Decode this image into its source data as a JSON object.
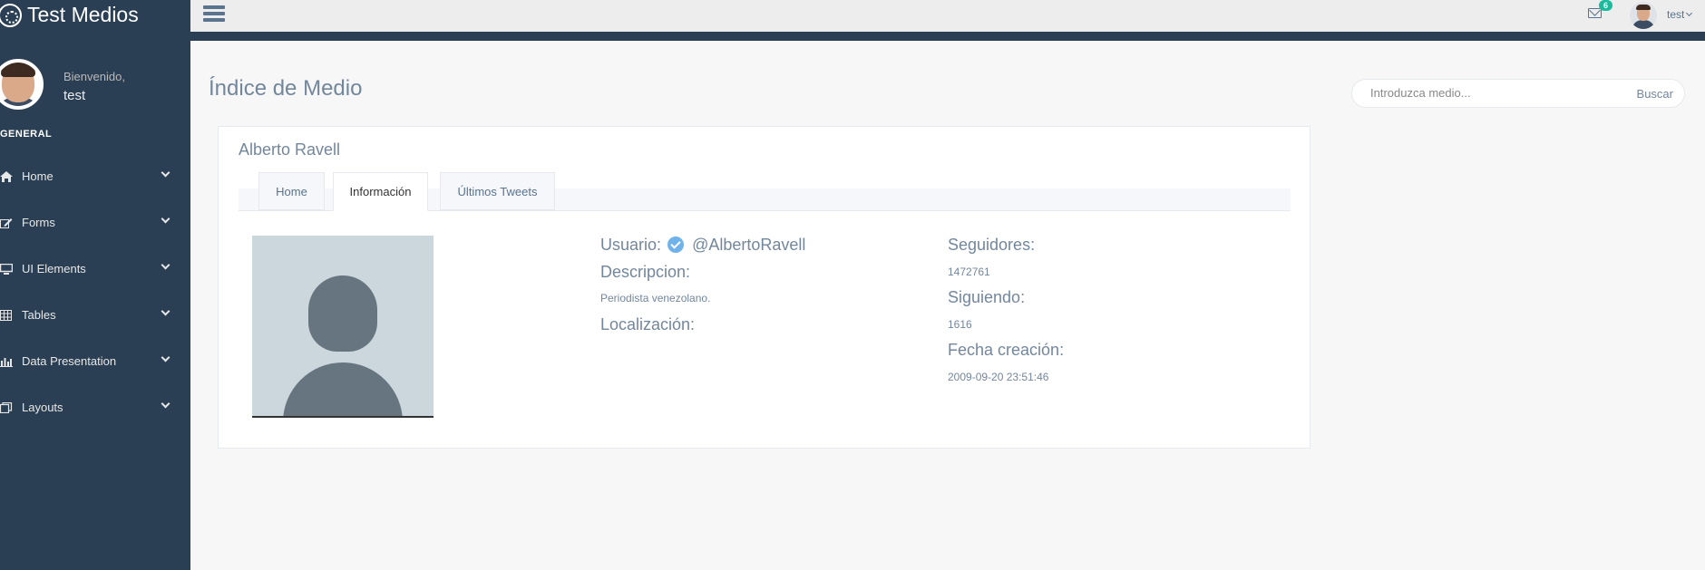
{
  "app": {
    "title": "Test Medios"
  },
  "sidebar": {
    "welcome": "Bienvenido,",
    "username": "test",
    "section": "GENERAL",
    "items": [
      {
        "label": "Home",
        "icon": "home-icon"
      },
      {
        "label": "Forms",
        "icon": "edit-icon"
      },
      {
        "label": "UI Elements",
        "icon": "desktop-icon"
      },
      {
        "label": "Tables",
        "icon": "table-icon"
      },
      {
        "label": "Data Presentation",
        "icon": "bar-chart-icon"
      },
      {
        "label": "Layouts",
        "icon": "clone-icon"
      }
    ]
  },
  "topbar": {
    "mail_count": "6",
    "user": "test"
  },
  "page": {
    "title": "Índice de Medio",
    "search": {
      "placeholder": "Introduzca medio...",
      "button": "Buscar"
    }
  },
  "panel": {
    "title": "Alberto Ravell",
    "tabs": [
      {
        "label": "Home"
      },
      {
        "label": "Información"
      },
      {
        "label": "Últimos Tweets"
      }
    ],
    "active_tab": "Información",
    "info": {
      "user_label": "Usuario:",
      "user_value": "@AlbertoRavell",
      "desc_label": "Descripcion:",
      "desc_value": "Periodista venezolano.",
      "location_label": "Localización:",
      "followers_label": "Seguidores:",
      "followers_value": "1472761",
      "following_label": "Siguiendo:",
      "following_value": "1616",
      "created_label": "Fecha creación:",
      "created_value": "2009-09-20 23:51:46"
    }
  },
  "colors": {
    "sidebar_bg": "#2a3f54",
    "badge": "#1abb9c",
    "text": "#73879c",
    "verified": "#6fb3ea"
  }
}
